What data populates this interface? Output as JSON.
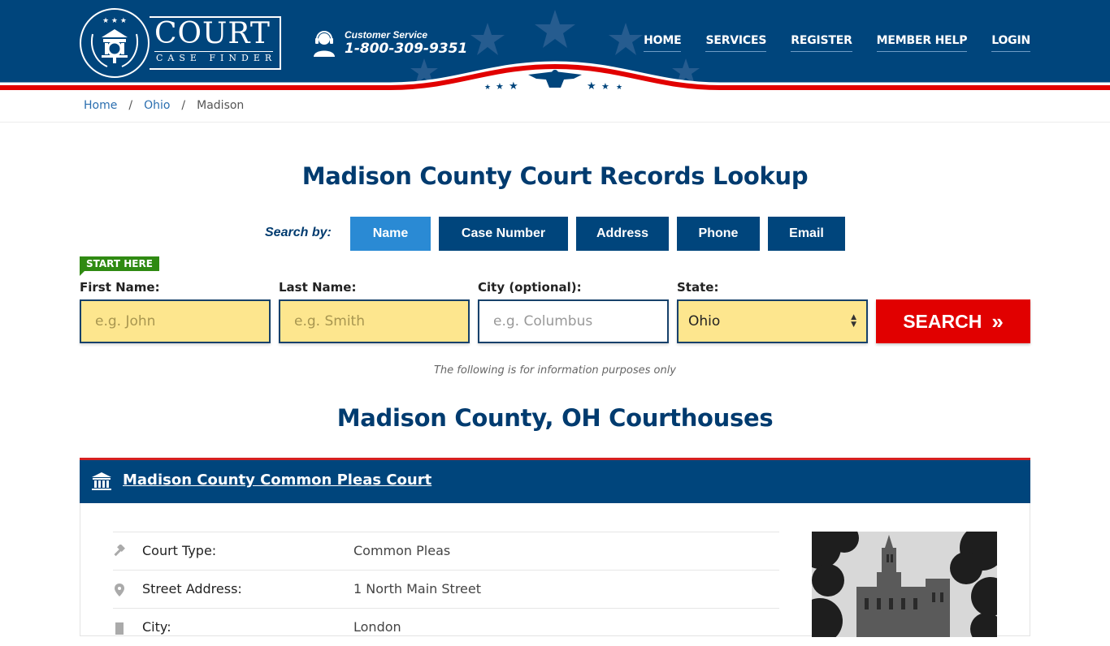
{
  "header": {
    "logo": {
      "title": "COURT",
      "subtitle": "CASE FINDER"
    },
    "customer_service": {
      "label": "Customer Service",
      "phone": "1-800-309-9351"
    },
    "nav": [
      "HOME",
      "SERVICES",
      "REGISTER",
      "MEMBER HELP",
      "LOGIN"
    ]
  },
  "breadcrumb": {
    "items": [
      "Home",
      "Ohio"
    ],
    "current": "Madison"
  },
  "search": {
    "title": "Madison County Court Records Lookup",
    "search_by_label": "Search by:",
    "tabs": [
      {
        "label": "Name",
        "active": true
      },
      {
        "label": "Case Number",
        "active": false
      },
      {
        "label": "Address",
        "active": false
      },
      {
        "label": "Phone",
        "active": false
      },
      {
        "label": "Email",
        "active": false
      }
    ],
    "start_here": "START HERE",
    "fields": {
      "first_name": {
        "label": "First Name:",
        "placeholder": "e.g. John"
      },
      "last_name": {
        "label": "Last Name:",
        "placeholder": "e.g. Smith"
      },
      "city": {
        "label": "City (optional):",
        "placeholder": "e.g.  Columbus"
      },
      "state": {
        "label": "State:",
        "value": "Ohio"
      }
    },
    "button": "SEARCH",
    "disclaimer": "The following is for information purposes only"
  },
  "courthouses": {
    "title": "Madison County, OH Courthouses",
    "cards": [
      {
        "name": "Madison County Common Pleas Court",
        "rows": [
          {
            "label": "Court Type:",
            "value": "Common Pleas"
          },
          {
            "label": "Street Address:",
            "value": "1 North Main Street"
          },
          {
            "label": "City:",
            "value": "London"
          }
        ]
      }
    ]
  },
  "colors": {
    "navy": "#00457c",
    "accent_blue": "#2a8ad4",
    "red": "#e10000",
    "green": "#2f8a12",
    "input_yellow": "#fde68e"
  }
}
